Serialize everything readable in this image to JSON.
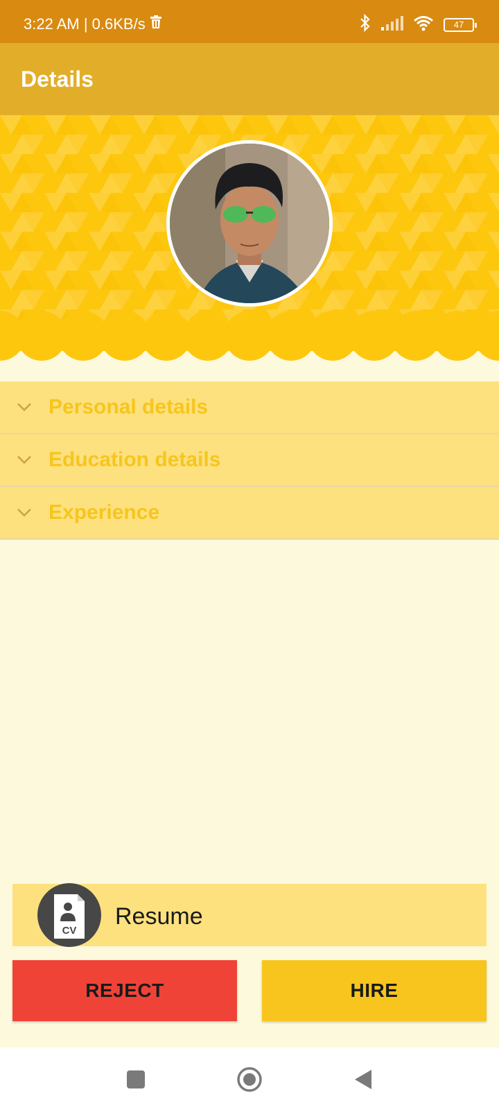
{
  "status_bar": {
    "time_speed": "3:22 AM | 0.6KB/s",
    "battery": "47",
    "icons": [
      "trash-icon",
      "bluetooth-icon",
      "signal-icon",
      "wifi-icon",
      "battery-icon"
    ]
  },
  "app_bar": {
    "title": "Details"
  },
  "profile": {
    "avatar": "profile-photo"
  },
  "sections": [
    {
      "label": "Personal details"
    },
    {
      "label": "Education details"
    },
    {
      "label": "Experience"
    }
  ],
  "resume": {
    "icon_text": "CV",
    "label": "Resume"
  },
  "actions": {
    "reject": "REJECT",
    "hire": "HIRE"
  },
  "colors": {
    "status_bar": "#d98a10",
    "app_bar": "#e2ae2a",
    "header": "#fdc70e",
    "accordion": "#fde17f",
    "accordion_text": "#f7c51c",
    "background": "#fdf9dc",
    "reject": "#f04337",
    "hire": "#f8c51e"
  },
  "nav_bar": {
    "icons": [
      "recent-apps-icon",
      "home-icon",
      "back-icon"
    ]
  }
}
